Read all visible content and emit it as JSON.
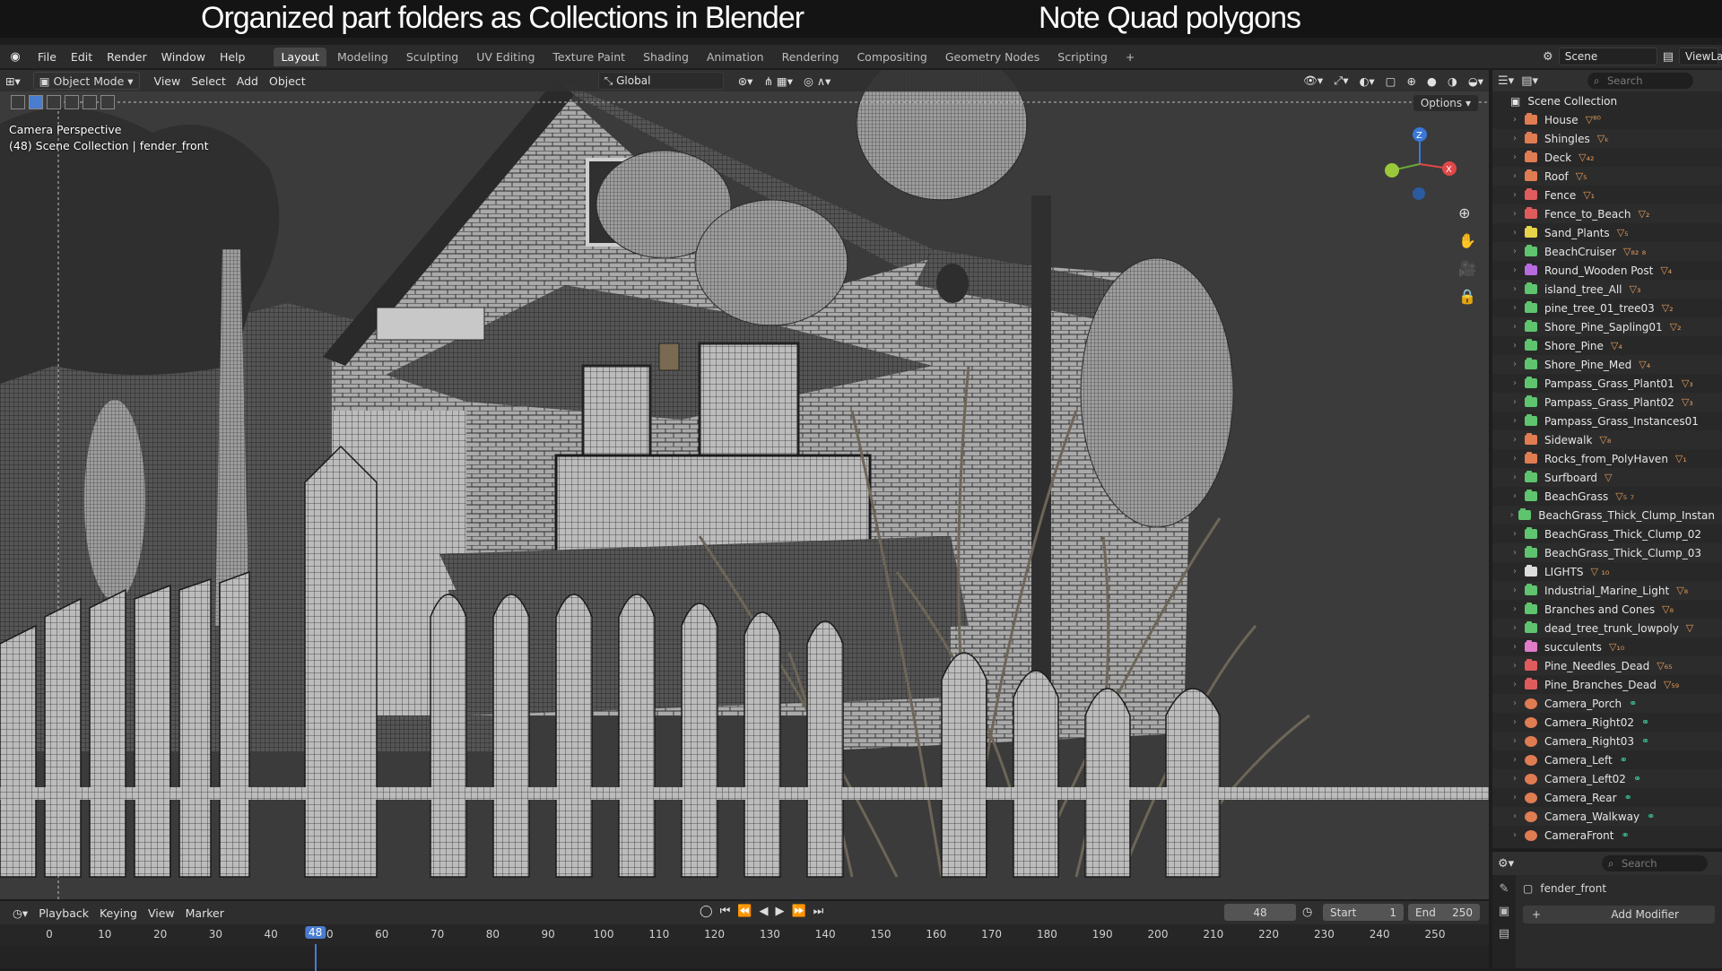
{
  "captions": {
    "left": "Organized part  folders as Collections in Blender",
    "right": "Note Quad polygons"
  },
  "menu": [
    "File",
    "Edit",
    "Render",
    "Window",
    "Help"
  ],
  "workspaces": [
    "Layout",
    "Modeling",
    "Sculpting",
    "UV Editing",
    "Texture Paint",
    "Shading",
    "Animation",
    "Rendering",
    "Compositing",
    "Geometry Nodes",
    "Scripting"
  ],
  "active_workspace": "Layout",
  "top_right": {
    "scene": "Scene",
    "view_layer": "ViewLa"
  },
  "viewport": {
    "mode": "Object Mode",
    "header_menu": [
      "View",
      "Select",
      "Add",
      "Object"
    ],
    "orientation": "Global",
    "options_label": "Options",
    "info_line1": "Camera Perspective",
    "info_line2": "(48) Scene Collection | fender_front"
  },
  "outliner": {
    "search_placeholder": "Search",
    "root": "Scene Collection",
    "items": [
      {
        "name": "House",
        "color": "#e07c52",
        "extra": "▽⁸⁰"
      },
      {
        "name": "Shingles",
        "color": "#e07c52",
        "extra": "▽ₖ"
      },
      {
        "name": "Deck",
        "color": "#e07c52",
        "extra": "▽₄₂"
      },
      {
        "name": "Roof",
        "color": "#e07c52",
        "extra": "▽₅"
      },
      {
        "name": "Fence",
        "color": "#e05c5c",
        "extra": "▽₁"
      },
      {
        "name": "Fence_to_Beach",
        "color": "#e05c5c",
        "extra": "▽₂"
      },
      {
        "name": "Sand_Plants",
        "color": "#e8d44a",
        "extra": "▽₅"
      },
      {
        "name": "BeachCruiser",
        "color": "#5fc46e",
        "extra": "▽₈₂ ₈"
      },
      {
        "name": "Round_Wooden Post",
        "color": "#b86adf",
        "extra": "▽₄"
      },
      {
        "name": "island_tree_All",
        "color": "#5fc46e",
        "extra": "▽₃"
      },
      {
        "name": "pine_tree_01_tree03",
        "color": "#5fc46e",
        "extra": "▽₂"
      },
      {
        "name": "Shore_Pine_Sapling01",
        "color": "#5fc46e",
        "extra": "▽₂"
      },
      {
        "name": "Shore_Pine",
        "color": "#5fc46e",
        "extra": "▽₄"
      },
      {
        "name": "Shore_Pine_Med",
        "color": "#5fc46e",
        "extra": "▽₄"
      },
      {
        "name": "Pampass_Grass_Plant01",
        "color": "#5fc46e",
        "extra": "▽₃"
      },
      {
        "name": "Pampass_Grass_Plant02",
        "color": "#5fc46e",
        "extra": "▽₃"
      },
      {
        "name": "Pampass_Grass_Instances01",
        "color": "#5fc46e",
        "extra": ""
      },
      {
        "name": "Sidewalk",
        "color": "#e07c52",
        "extra": "▽₈"
      },
      {
        "name": "Rocks_from_PolyHaven",
        "color": "#e07c52",
        "extra": "▽₁"
      },
      {
        "name": "Surfboard",
        "color": "#5fc46e",
        "extra": "▽"
      },
      {
        "name": "BeachGrass",
        "color": "#5fc46e",
        "extra": "▽₅ ₇"
      },
      {
        "name": "BeachGrass_Thick_Clump_Instan",
        "color": "#5fc46e",
        "extra": ""
      },
      {
        "name": "BeachGrass_Thick_Clump_02",
        "color": "#5fc46e",
        "extra": ""
      },
      {
        "name": "BeachGrass_Thick_Clump_03",
        "color": "#5fc46e",
        "extra": ""
      },
      {
        "name": "LIGHTS",
        "color": "#dddddd",
        "extra": "▽ ₁₀"
      },
      {
        "name": "Industrial_Marine_Light",
        "color": "#5fc46e",
        "extra": "▽₈"
      },
      {
        "name": "Branches and Cones",
        "color": "#5fc46e",
        "extra": "▽₈"
      },
      {
        "name": "dead_tree_trunk_lowpoly",
        "color": "#5fc46e",
        "extra": "▽"
      },
      {
        "name": "succulents",
        "color": "#e07cc8",
        "extra": "▽₁₀"
      },
      {
        "name": "Pine_Needles_Dead",
        "color": "#e05c5c",
        "extra": "▽₆₅"
      },
      {
        "name": "Pine_Branches_Dead",
        "color": "#e05c5c",
        "extra": "▽₅₉"
      }
    ],
    "cameras": [
      "Camera_Porch",
      "Camera_Right02",
      "Camera_Right03",
      "Camera_Left",
      "Camera_Left02",
      "Camera_Rear",
      "Camera_Walkway",
      "CameraFront"
    ]
  },
  "properties": {
    "search_placeholder": "Search",
    "object_name": "fender_front",
    "add_modifier": "Add Modifier"
  },
  "timeline": {
    "menu": [
      "Playback",
      "Keying",
      "View",
      "Marker"
    ],
    "current_frame": 48,
    "start_label": "Start",
    "start": 1,
    "end_label": "End",
    "end": 250,
    "ticks": [
      0,
      10,
      20,
      30,
      40,
      50,
      60,
      70,
      80,
      90,
      100,
      110,
      120,
      130,
      140,
      150,
      160,
      170,
      180,
      190,
      200,
      210,
      220,
      230,
      240,
      250
    ]
  },
  "colors": {
    "accent": "#4a7ccf",
    "wire_bg": "#3e3e3e",
    "wire_line": "#1a1a1a",
    "surface": "#bdbdbd"
  }
}
